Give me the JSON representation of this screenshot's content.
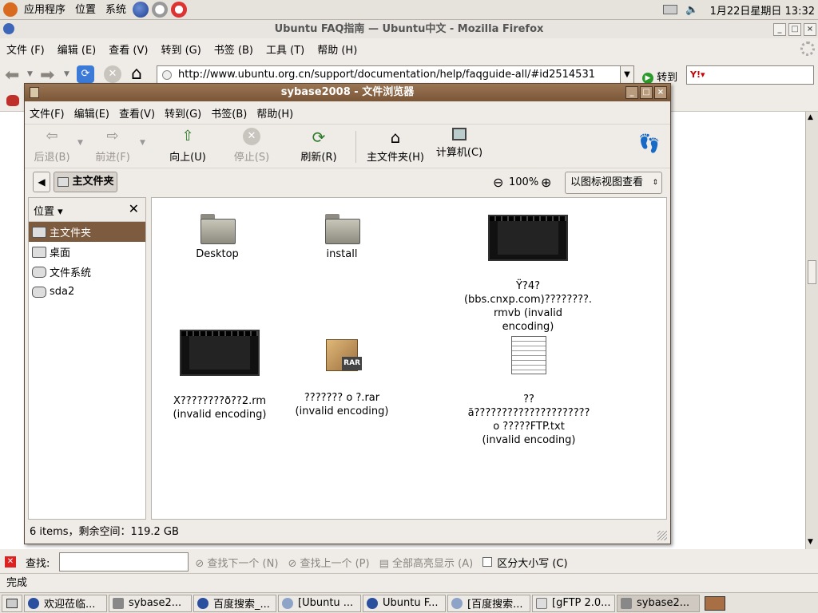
{
  "top_panel": {
    "menus": [
      "应用程序",
      "位置",
      "系统"
    ],
    "clock": "1月22日星期日 13:32"
  },
  "firefox": {
    "title": "Ubuntu FAQ指南 — Ubuntu中文 - Mozilla Firefox",
    "menu": [
      "文件 (F)",
      "编辑 (E)",
      "查看 (V)",
      "转到 (G)",
      "书签 (B)",
      "工具 (T)",
      "帮助 (H)"
    ],
    "url": "http://www.ubuntu.org.cn/support/documentation/help/faqguide-all/#id2514531",
    "go_label": "转到",
    "find": {
      "label": "查找:",
      "next": "查找下一个 (N)",
      "prev": "查找上一个 (P)",
      "highlight": "全部高亮显示 (A)",
      "case": "区分大小写 (C)"
    },
    "status": "完成"
  },
  "nautilus": {
    "title": "sybase2008 - 文件浏览器",
    "menu": [
      "文件(F)",
      "编辑(E)",
      "查看(V)",
      "转到(G)",
      "书签(B)",
      "帮助(H)"
    ],
    "toolbar": {
      "back": "后退(B)",
      "forward": "前进(F)",
      "up": "向上(U)",
      "stop": "停止(S)",
      "reload": "刷新(R)",
      "home": "主文件夹(H)",
      "computer": "计算机(C)"
    },
    "location_button": "主文件夹",
    "zoom": "100%",
    "view_mode": "以图标视图查看",
    "sidebar": {
      "title": "位置",
      "items": [
        "主文件夹",
        "桌面",
        "文件系统",
        "sda2"
      ]
    },
    "files": [
      {
        "name": "Desktop"
      },
      {
        "name": "install"
      },
      {
        "name": "Ÿ?4?\n(bbs.cnxp.com)????????.\nrmvb (invalid\nencoding)"
      },
      {
        "name": "X????????ð??2.rm\n(invalid encoding)"
      },
      {
        "name": "??????? o ?.rar\n(invalid encoding)"
      },
      {
        "name": "??\nã?????????????????????\no ?????FTP.txt\n(invalid encoding)"
      }
    ],
    "status": "6 items，剩余空间：119.2 GB"
  },
  "taskbar": {
    "items": [
      "欢迎莅临...",
      "sybase2...",
      "百度搜索_...",
      "[Ubuntu ...",
      "Ubuntu F...",
      "[百度搜索...",
      "[gFTP 2.0...",
      "sybase2..."
    ]
  },
  "colors": {
    "title_active": "#7d5b3f",
    "selection": "#7d5b3f",
    "panel": "#e6e2dc"
  }
}
